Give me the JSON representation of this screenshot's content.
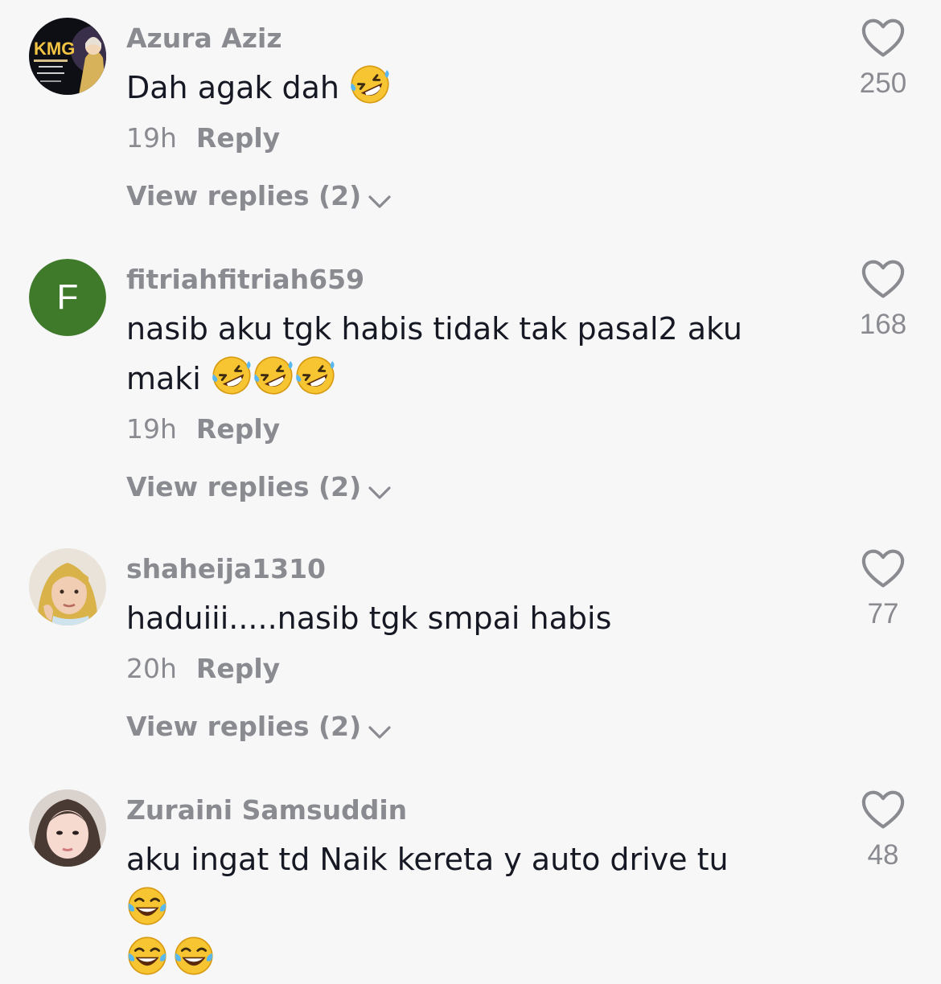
{
  "comments": [
    {
      "username": "Azura Aziz",
      "text": "Dah agak dah",
      "emoji_count": 1,
      "emoji_name": "rolling-on-floor-laughing",
      "time": "19h",
      "reply_label": "Reply",
      "view_replies": "View replies (2)",
      "likes": "250",
      "avatar_text": "KMG"
    },
    {
      "username": "fitriahfitriah659",
      "text_line1": "nasib aku tgk habis tidak tak pasal2 aku",
      "text_line2": "maki",
      "emoji_count": 3,
      "emoji_name": "rolling-on-floor-laughing",
      "time": "19h",
      "reply_label": "Reply",
      "view_replies": "View replies (2)",
      "likes": "168",
      "avatar_letter": "F",
      "avatar_color": "#3f7a2b"
    },
    {
      "username": "shaheija1310",
      "text": "haduiii.....nasib tgk smpai habis",
      "time": "20h",
      "reply_label": "Reply",
      "view_replies": "View replies (2)",
      "likes": "77"
    },
    {
      "username": "Zuraini Samsuddin",
      "text": "aku ingat td Naik kereta y auto drive tu",
      "emoji_name": "face-with-tears-of-joy",
      "likes": "48"
    }
  ],
  "colors": {
    "background": "#f7f7f8",
    "primary_text": "#161823",
    "secondary_text": "#8a8b91",
    "emoji_yellow": "#f7c531"
  },
  "icons": {
    "like": "heart-outline-icon",
    "expand": "chevron-down-icon"
  }
}
